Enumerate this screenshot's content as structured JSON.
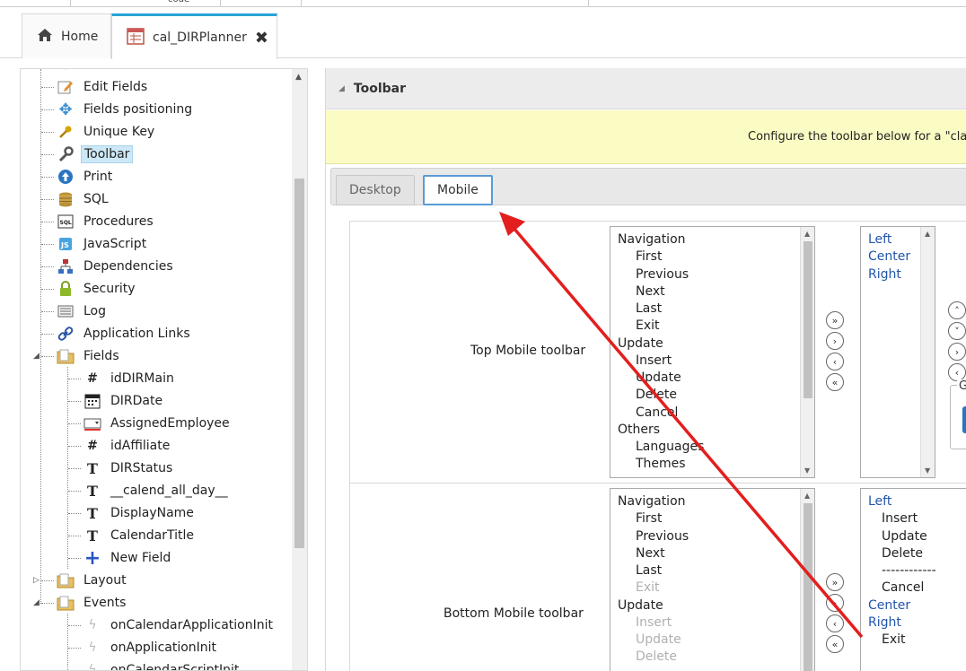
{
  "top_strip": {
    "cut_text": "code"
  },
  "tabs": [
    {
      "label": "Home",
      "icon": "home-icon"
    },
    {
      "label": "cal_DIRPlanner",
      "icon": "calendar-icon",
      "close_icon": "close-icon"
    }
  ],
  "tree": {
    "items": [
      {
        "label": "Edit Fields",
        "icon": "edit-icon"
      },
      {
        "label": "Fields positioning",
        "icon": "move-icon"
      },
      {
        "label": "Unique Key",
        "icon": "key-icon"
      },
      {
        "label": "Toolbar",
        "icon": "wrench-icon",
        "selected": true
      },
      {
        "label": "Print",
        "icon": "print-icon"
      },
      {
        "label": "SQL",
        "icon": "database-icon"
      },
      {
        "label": "Procedures",
        "icon": "sql-icon"
      },
      {
        "label": "JavaScript",
        "icon": "js-icon"
      },
      {
        "label": "Dependencies",
        "icon": "hierarchy-icon"
      },
      {
        "label": "Security",
        "icon": "lock-icon"
      },
      {
        "label": "Log",
        "icon": "log-icon"
      },
      {
        "label": "Application Links",
        "icon": "link-icon"
      },
      {
        "label": "Fields",
        "icon": "folder-icon"
      },
      {
        "label": "idDIRMain",
        "icon": "hash-icon"
      },
      {
        "label": "DIRDate",
        "icon": "calendar-field-icon"
      },
      {
        "label": "AssignedEmployee",
        "icon": "select-field-icon"
      },
      {
        "label": "idAffiliate",
        "icon": "hash-icon"
      },
      {
        "label": "DIRStatus",
        "icon": "text-icon"
      },
      {
        "label": "__calend_all_day__",
        "icon": "text-icon"
      },
      {
        "label": "DisplayName",
        "icon": "text-icon"
      },
      {
        "label": "CalendarTitle",
        "icon": "text-icon"
      },
      {
        "label": "New Field",
        "icon": "plus-icon"
      },
      {
        "label": "Layout",
        "icon": "folder-icon"
      },
      {
        "label": "Events",
        "icon": "folder-icon"
      },
      {
        "label": "onCalendarApplicationInit",
        "icon": "lightning-icon"
      },
      {
        "label": "onApplicationInit",
        "icon": "lightning-icon"
      },
      {
        "label": "onCalendarScriptInit",
        "icon": "lightning-icon"
      }
    ]
  },
  "panel": {
    "title": "Toolbar",
    "notice": "Configure the toolbar below for a \"clas",
    "modes": [
      {
        "label": "Desktop"
      },
      {
        "label": "Mobile",
        "active": true
      }
    ],
    "top_row": {
      "label": "Top Mobile toolbar",
      "available": [
        {
          "t": "Navigation"
        },
        {
          "t": "First",
          "sub": true
        },
        {
          "t": "Previous",
          "sub": true
        },
        {
          "t": "Next",
          "sub": true
        },
        {
          "t": "Last",
          "sub": true
        },
        {
          "t": "Exit",
          "sub": true
        },
        {
          "t": "Update"
        },
        {
          "t": "Insert",
          "sub": true
        },
        {
          "t": "Update",
          "sub": true
        },
        {
          "t": "Delete",
          "sub": true
        },
        {
          "t": "Cancel",
          "sub": true
        },
        {
          "t": "Others"
        },
        {
          "t": "Languages",
          "sub": true
        },
        {
          "t": "Themes",
          "sub": true
        }
      ],
      "selected": [
        {
          "t": "Left"
        },
        {
          "t": "Center"
        },
        {
          "t": "Right"
        }
      ]
    },
    "bottom_row": {
      "label": "Bottom Mobile toolbar",
      "available": [
        {
          "t": "Navigation"
        },
        {
          "t": "First",
          "sub": true
        },
        {
          "t": "Previous",
          "sub": true
        },
        {
          "t": "Next",
          "sub": true
        },
        {
          "t": "Last",
          "sub": true
        },
        {
          "t": "Exit",
          "sub": true,
          "dim": true
        },
        {
          "t": "Update"
        },
        {
          "t": "Insert",
          "sub": true,
          "dim": true
        },
        {
          "t": "Update",
          "sub": true,
          "dim": true
        },
        {
          "t": "Delete",
          "sub": true,
          "dim": true
        }
      ],
      "selected": [
        {
          "t": "Left",
          "blue": true
        },
        {
          "t": "Insert",
          "sub": true
        },
        {
          "t": "Update",
          "sub": true
        },
        {
          "t": "Delete",
          "sub": true
        },
        {
          "t": "------------",
          "sub": true
        },
        {
          "t": "Cancel",
          "sub": true
        },
        {
          "t": "Center",
          "blue": true
        },
        {
          "t": "Right",
          "blue": true
        },
        {
          "t": "Exit",
          "sub": true
        }
      ]
    },
    "move_buttons": [
      "move-all-right-icon",
      "move-right-icon",
      "move-left-icon",
      "move-all-left-icon"
    ],
    "order_buttons": [
      "move-up-icon",
      "move-down-icon",
      "move-right-icon",
      "move-left-icon"
    ]
  },
  "colors": {
    "accent": "#29a3d9",
    "notice_bg": "#fbfbc4",
    "annotation_arrow": "#e31e1e",
    "selected_bg": "#cde8f6",
    "link_blue": "#2255aa"
  }
}
